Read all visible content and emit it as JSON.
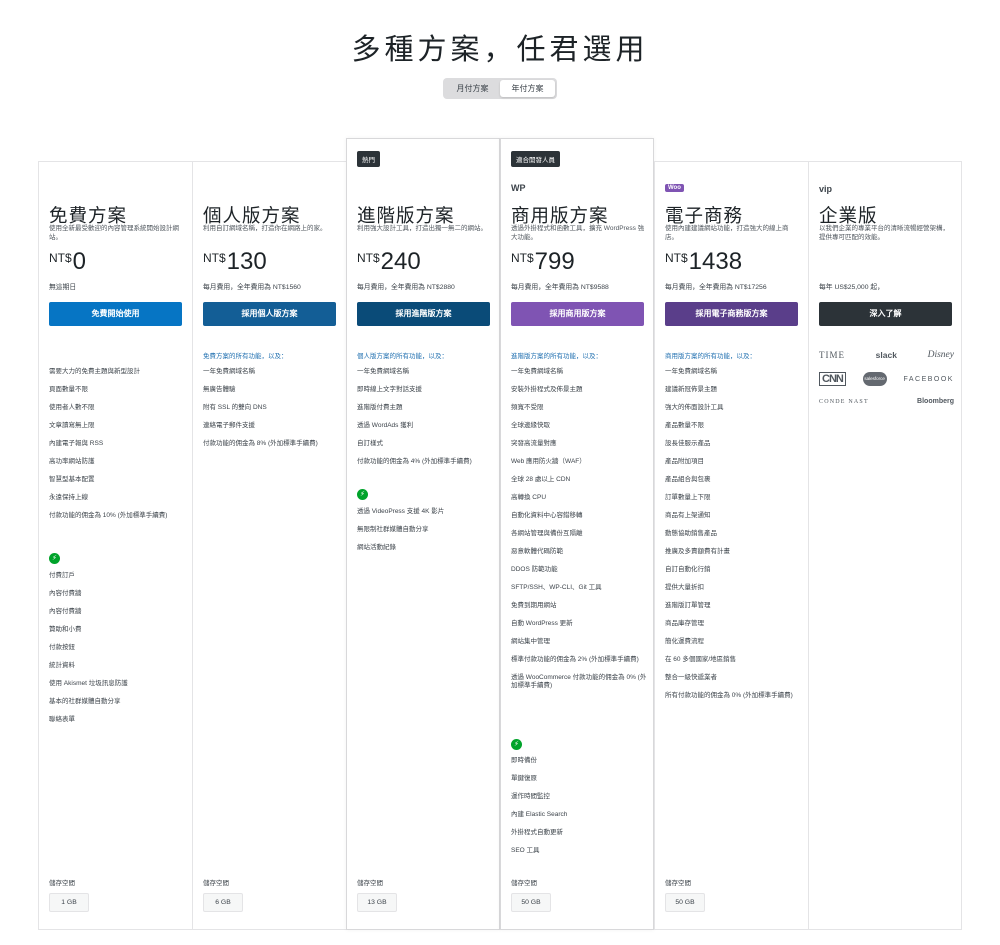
{
  "page": {
    "title": "多種方案，任君選用",
    "toggle": {
      "monthly": "月付方案",
      "yearly": "年付方案"
    }
  },
  "colors": {
    "free": "#0675c4",
    "personal": "#135e96",
    "premium": "#0a4b78",
    "business": "#7f54b3",
    "ecommerce": "#5a3e8a",
    "vip": "#2c3338"
  },
  "plans": {
    "free": {
      "name": "免費方案",
      "desc": "使用全新最受歡迎的內容管理系統開始設計網站。",
      "currency": "NT$",
      "price": "0",
      "price_note": "無這期日",
      "cta": "免費開始使用",
      "features": [
        "需要大力的免費主題與新型設計",
        "頁面數量不限",
        "使用者人數不限",
        "文章讀寫無上限",
        "內建電子報與 RSS",
        "高功率網站防護",
        "智慧型基本配置",
        "永遠保持上線",
        "付款功能的佣金為 10% (外加標準手續費)"
      ],
      "extras": [
        "付費訂戶",
        "內容付費牆",
        "內容付費牆",
        "贊助和小費",
        "付款按鈕",
        "統計資料",
        "使用 Akismet 垃圾訊息防護",
        "基本的社群媒體自動分享",
        "聯絡表單"
      ],
      "storage_label": "儲存空間",
      "storage": "1 GB"
    },
    "personal": {
      "name": "個人版方案",
      "desc": "利用自訂網域名稱，打造你在網路上的家。",
      "currency": "NT$",
      "price": "130",
      "price_note": "每月費用，全年費用為 NT$1560",
      "cta": "採用個人版方案",
      "feat_head": "免費方案的所有功能，以及：",
      "features": [
        "一年免費網域名稱",
        "無廣告體驗",
        "附有 SSL 的雙向 DNS",
        "連絡電子郵件支援",
        "付款功能的佣金為 8% (外加標準手續費)"
      ],
      "storage_label": "儲存空間",
      "storage": "6 GB"
    },
    "premium": {
      "badge": "熱門",
      "name": "進階版方案",
      "desc": "利用強大設計工具，打造出獨一無二的網站。",
      "currency": "NT$",
      "price": "240",
      "price_note": "每月費用，全年費用為 NT$2880",
      "cta": "採用進階版方案",
      "feat_head": "個人版方案的所有功能，以及：",
      "features": [
        "一年免費網域名稱",
        "即時線上文字對話支援",
        "進階版付費主題",
        "透過 WordAds 獲利",
        "自訂樣式",
        "付款功能的佣金為 4% (外加標準手續費)"
      ],
      "extras": [
        "透過 VideoPress 支援 4K 影片",
        "無限制社群媒體自動分享",
        "網站活動紀錄"
      ],
      "storage_label": "儲存空間",
      "storage": "13 GB"
    },
    "business": {
      "badge": "適合開發人員",
      "logo": "WP",
      "name": "商用版方案",
      "desc": "透過外掛程式和函數工具，擴充 WordPress 強大功能。",
      "currency": "NT$",
      "price": "799",
      "price_note": "每月費用，全年費用為 NT$9588",
      "cta": "採用商用版方案",
      "feat_head": "進階版方案的所有功能，以及：",
      "features": [
        "一年免費網域名稱",
        "安裝外掛程式及佈景主題",
        "頻寬不受限",
        "全球邊緣快取",
        "突發高流量對應",
        "Web 應用防火牆（WAF）",
        "全球 28 處以上 CDN",
        "高轉換 CPU",
        "自動化資料中心容錯移轉",
        "各網站管理與備份互隔離",
        "惡意軟體代碼防範",
        "DDOS 防範功能",
        "SFTP/SSH、WP-CLI、Git 工具",
        "免費到期用網站",
        "自動 WordPress 更新",
        "網站集中管理",
        "標準付款功能的佣金為 2% (外加標準手續費)",
        "透過 WooCommerce 付款功能的佣金為 0% (外加標準手續費)"
      ],
      "extras": [
        "即時備份",
        "單鍵復原",
        "運作時間監控",
        "內建 Elastic Search",
        "外掛程式自動更新",
        "SEO 工具"
      ],
      "storage_label": "儲存空間",
      "storage": "50 GB"
    },
    "ecommerce": {
      "logo": "Woo",
      "name": "電子商務",
      "desc": "使用內建建議網站功能，打造強大的線上商店。",
      "currency": "NT$",
      "price": "1438",
      "price_note": "每月費用，全年費用為 NT$17256",
      "cta": "採用電子商務版方案",
      "feat_head": "商用版方案的所有功能，以及：",
      "features": [
        "一年免費網域名稱",
        "建議新冠佈景主題",
        "強大的佈面設計工具",
        "產品數量不限",
        "設長佳服示產品",
        "產品附加項目",
        "產品組合與包裹",
        "訂單數量上下限",
        "商品有上架通知",
        "動態協助銷售產品",
        "推廣及多賣額費有計畫",
        "自訂自動化行銷",
        "提供大量折扣",
        "進階版訂單管理",
        "商品庫存管理",
        "簡化運費流程",
        "在 60 多個國家/地區銷售",
        "整合一級快遞業者",
        "所有付款功能的佣金為 0% (外加標準手續費)"
      ],
      "storage_label": "儲存空間",
      "storage": "50 GB"
    },
    "vip": {
      "logo": "vip",
      "name": "企業版",
      "desc": "以我們企業的專業平台的清晰流暢經營架構，提供專可匹配的效能。",
      "price_note": "每年 US$25,000 起，",
      "cta": "深入了解",
      "clients": [
        "TIME",
        "slack",
        "Disney",
        "CNN",
        "salesforce",
        "FACEBOOK",
        "CONDE NAST",
        "Bloomberg"
      ]
    }
  }
}
